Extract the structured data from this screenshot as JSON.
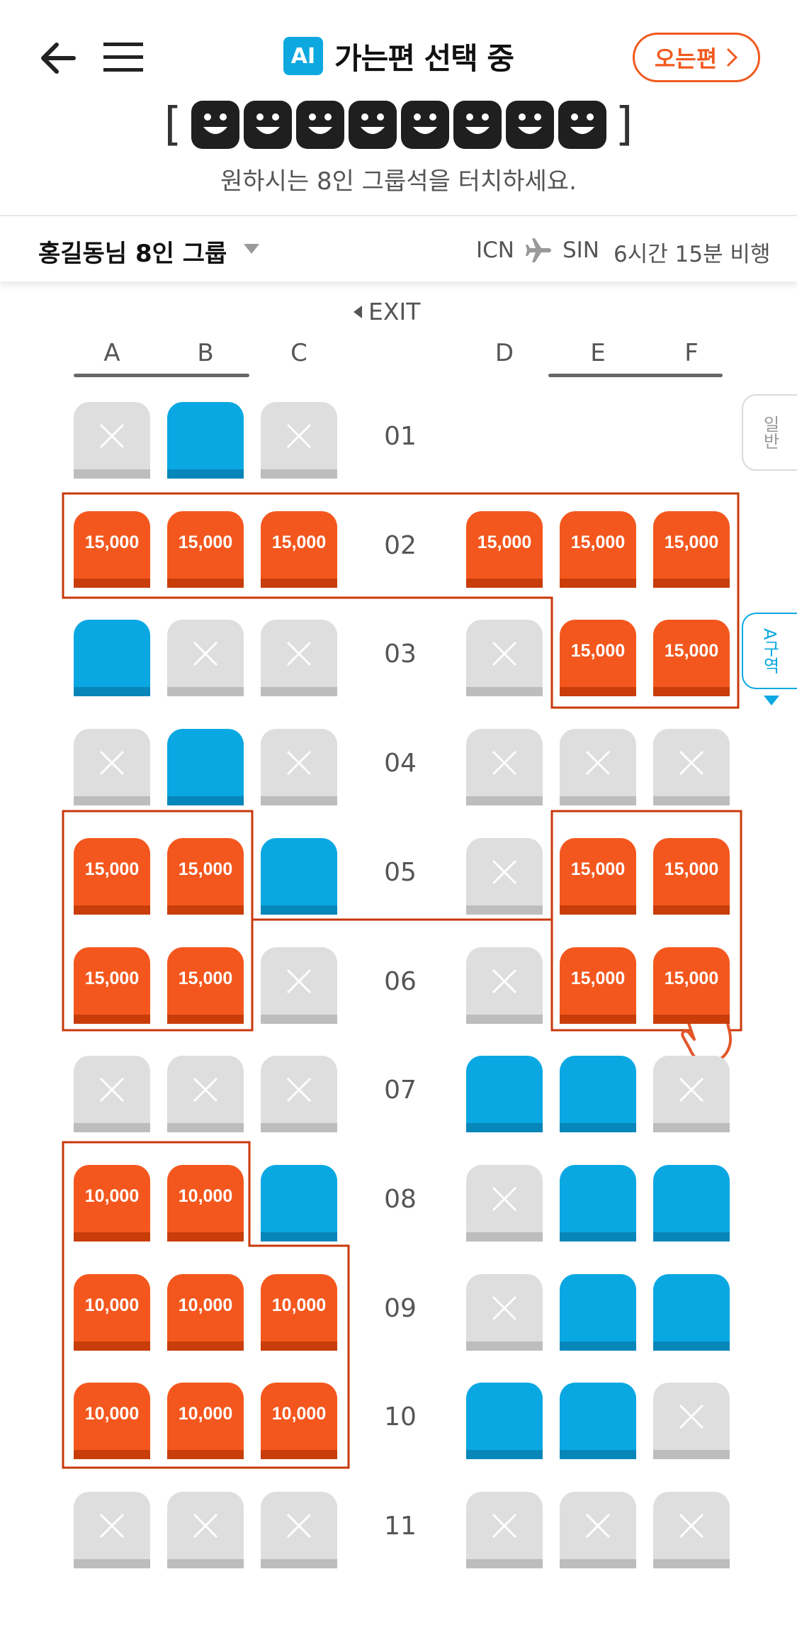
{
  "header": {
    "ai_badge": "AI",
    "title": "가는편 선택 중",
    "return_button": "오는편",
    "bracket_open": "[",
    "bracket_close": "]",
    "group_size_icons": 8,
    "subtitle": "원하시는 8인 그룹석을 터치하세요."
  },
  "info_bar": {
    "group_name": "홍길동님 8인 그룹",
    "origin": "ICN",
    "destination": "SIN",
    "duration": "6시간 15분 비행"
  },
  "seat_map": {
    "exit_label": "EXIT",
    "columns": [
      "A",
      "B",
      "C",
      "D",
      "E",
      "F"
    ],
    "rows": [
      {
        "num": "01",
        "seats": [
          "taken",
          "free",
          "taken",
          null,
          null,
          null
        ]
      },
      {
        "num": "02",
        "seats": [
          "15,000",
          "15,000",
          "15,000",
          "15,000",
          "15,000",
          "15,000"
        ]
      },
      {
        "num": "03",
        "seats": [
          "free",
          "taken",
          "taken",
          "taken",
          "15,000",
          "15,000"
        ]
      },
      {
        "num": "04",
        "seats": [
          "taken",
          "free",
          "taken",
          "taken",
          "taken",
          "taken"
        ]
      },
      {
        "num": "05",
        "seats": [
          "15,000",
          "15,000",
          "free",
          "taken",
          "15,000",
          "15,000"
        ]
      },
      {
        "num": "06",
        "seats": [
          "15,000",
          "15,000",
          "taken",
          "taken",
          "15,000",
          "15,000"
        ]
      },
      {
        "num": "07",
        "seats": [
          "taken",
          "taken",
          "taken",
          "free",
          "free",
          "taken"
        ]
      },
      {
        "num": "08",
        "seats": [
          "10,000",
          "10,000",
          "free",
          "taken",
          "free",
          "free"
        ]
      },
      {
        "num": "09",
        "seats": [
          "10,000",
          "10,000",
          "10,000",
          "taken",
          "free",
          "free"
        ]
      },
      {
        "num": "10",
        "seats": [
          "10,000",
          "10,000",
          "10,000",
          "free",
          "free",
          "taken"
        ]
      },
      {
        "num": "11",
        "seats": [
          "taken",
          "taken",
          "taken",
          "taken",
          "taken",
          "taken"
        ]
      }
    ]
  },
  "side_tabs": {
    "first": "일반",
    "second": "A구역"
  },
  "colors": {
    "accent_orange": "#f4571d",
    "available_blue": "#0aa8e2",
    "taken_gray": "#dedede",
    "group_outline": "#c8380a"
  }
}
